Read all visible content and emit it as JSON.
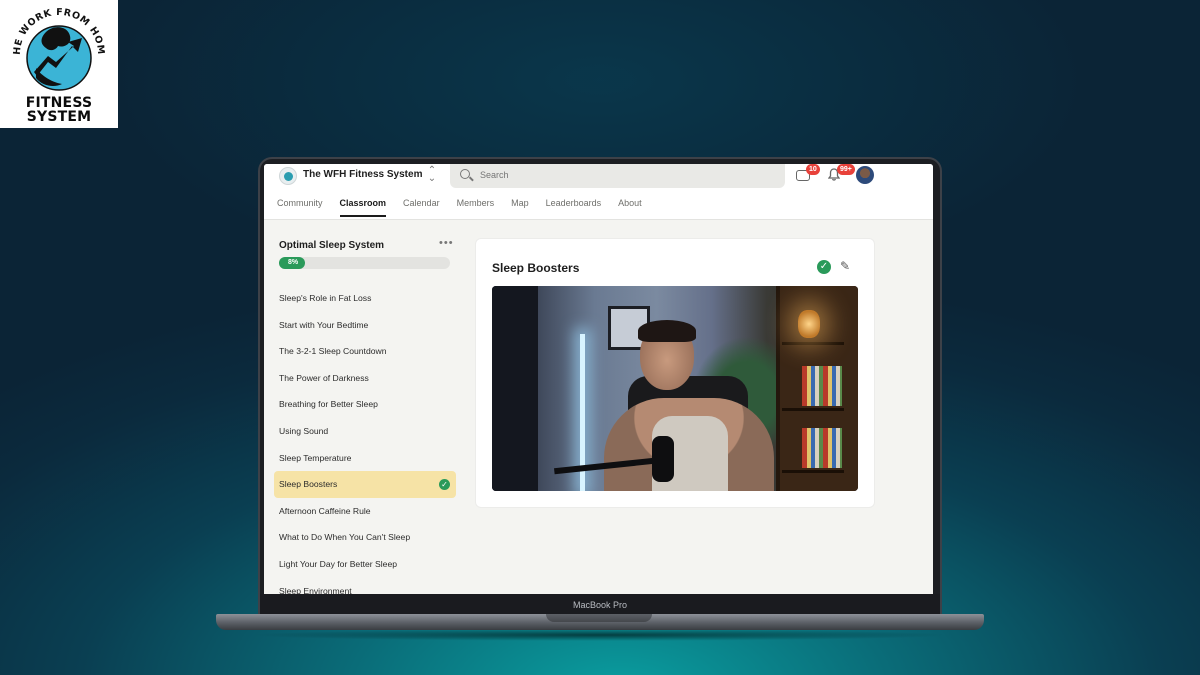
{
  "logo": {
    "arc_text": "THE WORK FROM HOME",
    "word1": "FITNESS",
    "word2": "SYSTEM"
  },
  "device": {
    "label": "MacBook Pro"
  },
  "header": {
    "community_name": "The WFH Fitness System",
    "search_placeholder": "Search",
    "chat_badge": "10",
    "notifications_badge": "99+",
    "tabs": [
      {
        "label": "Community",
        "active": false
      },
      {
        "label": "Classroom",
        "active": true
      },
      {
        "label": "Calendar",
        "active": false
      },
      {
        "label": "Members",
        "active": false
      },
      {
        "label": "Map",
        "active": false
      },
      {
        "label": "Leaderboards",
        "active": false
      },
      {
        "label": "About",
        "active": false
      }
    ]
  },
  "sidebar": {
    "course_title": "Optimal Sleep System",
    "progress_label": "8%",
    "progress_value": 0.08,
    "lessons": [
      {
        "label": "Sleep's Role in Fat Loss"
      },
      {
        "label": "Start with Your Bedtime"
      },
      {
        "label": "The 3-2-1 Sleep Countdown"
      },
      {
        "label": "The Power of Darkness"
      },
      {
        "label": "Breathing for Better Sleep"
      },
      {
        "label": "Using Sound"
      },
      {
        "label": "Sleep Temperature"
      },
      {
        "label": "Sleep Boosters",
        "active": true,
        "completed": true
      },
      {
        "label": "Afternoon Caffeine Rule"
      },
      {
        "label": "What to Do When You Can't Sleep"
      },
      {
        "label": "Light Your Day for Better Sleep"
      },
      {
        "label": "Sleep Environment"
      }
    ]
  },
  "main": {
    "lesson_title": "Sleep Boosters",
    "completed_icon": "check-circle-icon",
    "edit_icon": "pencil-icon"
  },
  "colors": {
    "progress_green": "#2a9a5a",
    "active_lesson_bg": "#f6e3a6",
    "badge_red": "#e8413a"
  }
}
